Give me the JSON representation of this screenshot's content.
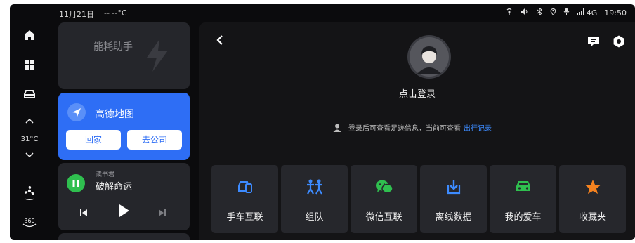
{
  "status": {
    "date": "11月21日",
    "weather": "-- --°C",
    "signal": "4G",
    "time": "19:50"
  },
  "left_rail": {
    "temperature": "31°C"
  },
  "energy_card": {
    "title": "能耗助手"
  },
  "map_card": {
    "title": "高德地图",
    "home_label": "回家",
    "company_label": "去公司",
    "accent": "#2e6ef5"
  },
  "music_card": {
    "source": "读书君",
    "title": "破解命运"
  },
  "main": {
    "login_label": "点击登录",
    "hint_text": "登录后可查看足迹信息，当前可查看",
    "hint_link": "出行记录",
    "link_color": "#3d8bff",
    "functions": [
      {
        "label": "手车互联",
        "icon": "phone-car-icon",
        "color": "#3d8bff"
      },
      {
        "label": "组队",
        "icon": "team-icon",
        "color": "#3d8bff"
      },
      {
        "label": "微信互联",
        "icon": "wechat-icon",
        "color": "#2fbf4f"
      },
      {
        "label": "离线数据",
        "icon": "offline-download-icon",
        "color": "#3d8bff"
      },
      {
        "label": "我的爱车",
        "icon": "my-car-icon",
        "color": "#2fbf4f"
      },
      {
        "label": "收藏夹",
        "icon": "star-icon",
        "color": "#f5821f"
      }
    ]
  }
}
